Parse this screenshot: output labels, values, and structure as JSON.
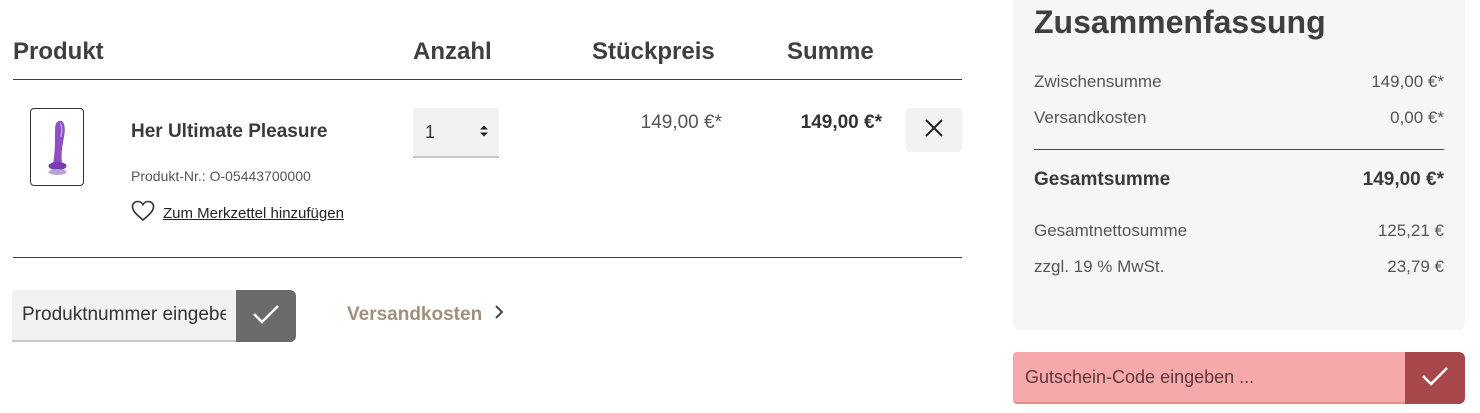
{
  "cart": {
    "headers": {
      "product": "Produkt",
      "quantity": "Anzahl",
      "unit_price": "Stückpreis",
      "total": "Summe"
    },
    "item": {
      "name": "Her Ultimate Pleasure",
      "product_number": "Produkt-Nr.: O-05443700000",
      "wishlist_label": "Zum Merkzettel hinzufügen",
      "quantity": "1",
      "unit_price": "149,00 €*",
      "total": "149,00 €*"
    },
    "product_number_input": {
      "placeholder": "Produktnummer eingeben ..."
    },
    "shipping_link": "Versandkosten"
  },
  "summary": {
    "title": "Zusammenfassung",
    "subtotal_label": "Zwischensumme",
    "subtotal_value": "149,00 €*",
    "shipping_label": "Versandkosten",
    "shipping_value": "0,00 €*",
    "grand_total_label": "Gesamtsumme",
    "grand_total_value": "149,00 €*",
    "net_total_label": "Gesamtnettosumme",
    "net_total_value": "125,21 €",
    "vat_label": "zzgl. 19 % MwSt.",
    "vat_value": "23,79 €"
  },
  "voucher": {
    "placeholder": "Gutschein-Code eingeben ..."
  },
  "colors": {
    "accent_link": "#a2907a",
    "voucher_bg": "#f7a8aa",
    "voucher_button": "#a6474c",
    "product_button": "#6b6b6b"
  }
}
